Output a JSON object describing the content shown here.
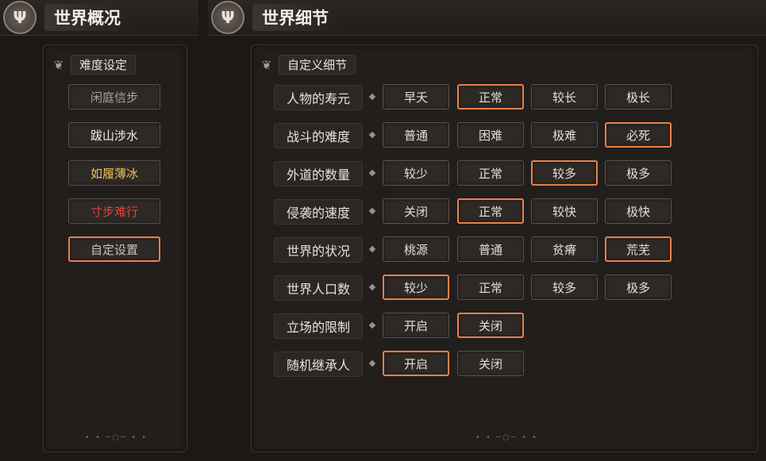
{
  "tabs": {
    "left_title": "世界概况",
    "right_title": "世界细节",
    "emblem_icon": "tree-icon"
  },
  "difficulty": {
    "title": "难度设定",
    "icon": "scroll-icon",
    "options": [
      {
        "label": "闲庭信步",
        "color": "#a9a39b",
        "selected": false
      },
      {
        "label": "跋山涉水",
        "color": "#f0ebe3",
        "selected": false
      },
      {
        "label": "如履薄冰",
        "color": "#e9c25a",
        "selected": false
      },
      {
        "label": "寸步难行",
        "color": "#e0453a",
        "selected": false
      },
      {
        "label": "自定设置",
        "color": "#c9c2b8",
        "selected": true
      }
    ]
  },
  "custom": {
    "title": "自定义细节",
    "icon": "scroll-icon",
    "rows": [
      {
        "label": "人物的寿元",
        "options": [
          "早夭",
          "正常",
          "较长",
          "极长"
        ],
        "selected": 1
      },
      {
        "label": "战斗的难度",
        "options": [
          "普通",
          "困难",
          "极难",
          "必死"
        ],
        "selected": 3
      },
      {
        "label": "外道的数量",
        "options": [
          "较少",
          "正常",
          "较多",
          "极多"
        ],
        "selected": 2
      },
      {
        "label": "侵袭的速度",
        "options": [
          "关闭",
          "正常",
          "较快",
          "极快"
        ],
        "selected": 1
      },
      {
        "label": "世界的状况",
        "options": [
          "桃源",
          "普通",
          "贫瘠",
          "荒芜"
        ],
        "selected": 3
      },
      {
        "label": "世界人口数",
        "options": [
          "较少",
          "正常",
          "较多",
          "极多"
        ],
        "selected": 0
      },
      {
        "label": "立场的限制",
        "options": [
          "开启",
          "关闭"
        ],
        "selected": 1
      },
      {
        "label": "随机继承人",
        "options": [
          "开启",
          "关闭"
        ],
        "selected": 0
      }
    ]
  },
  "colors": {
    "accent": "#e8814a"
  }
}
